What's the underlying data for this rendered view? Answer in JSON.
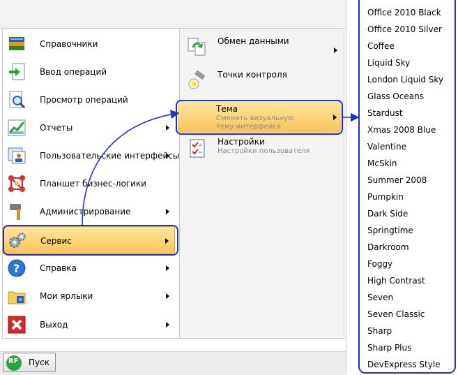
{
  "left_menu": {
    "items": [
      {
        "label": "Справочники",
        "icon": "books-icon",
        "has_submenu": false
      },
      {
        "label": "Ввод операций",
        "icon": "document-enter-icon",
        "has_submenu": false
      },
      {
        "label": "Просмотр операций",
        "icon": "document-search-icon",
        "has_submenu": false
      },
      {
        "label": "Отчеты",
        "icon": "chart-icon",
        "has_submenu": true
      },
      {
        "label": "Пользовательские интерфейсы",
        "icon": "user-interface-icon",
        "has_submenu": true
      },
      {
        "label": "Планшет бизнес-логики",
        "icon": "molecule-icon",
        "has_submenu": false
      },
      {
        "label": "Администрирование",
        "icon": "hammer-icon",
        "has_submenu": true
      },
      {
        "label": "Сервис",
        "icon": "gears-icon",
        "has_submenu": true,
        "active": true
      },
      {
        "label": "Справка",
        "icon": "help-icon",
        "has_submenu": true
      },
      {
        "label": "Мои ярлыки",
        "icon": "shortcuts-folder-icon",
        "has_submenu": true
      },
      {
        "label": "Выход",
        "icon": "exit-icon",
        "has_submenu": true
      }
    ]
  },
  "service_menu": {
    "items": [
      {
        "label": "Обмен данными",
        "icon": "data-exchange-icon",
        "has_submenu": true
      },
      {
        "label": "Точки контроля",
        "icon": "flashlight-icon",
        "has_submenu": false
      },
      {
        "label": "Тема",
        "description": "Сменить визуальную тему интерфейса",
        "icon": "theme-icon",
        "has_submenu": true,
        "active": true
      },
      {
        "label": "Настройки",
        "description": "Настройки пользователя",
        "icon": "settings-checklist-icon",
        "has_submenu": false
      }
    ]
  },
  "skins_menu": {
    "items": [
      "Office 2010 Black",
      "Office 2010 Silver",
      "Coffee",
      "Liquid Sky",
      "London Liquid Sky",
      "Glass Oceans",
      "Stardust",
      "Xmas 2008 Blue",
      "Valentine",
      "McSkin",
      "Summer 2008",
      "Pumpkin",
      "Dark Side",
      "Springtime",
      "Darkroom",
      "Foggy",
      "High Contrast",
      "Seven",
      "Seven Classic",
      "Sharp",
      "Sharp Plus",
      "DevExpress Style"
    ]
  },
  "taskbar": {
    "start_label": "Пуск",
    "logo_text": "RF"
  },
  "colors": {
    "highlight_top": "#fde79a",
    "highlight_bottom": "#fbc25a",
    "annotation_blue": "#1f2fd0"
  }
}
